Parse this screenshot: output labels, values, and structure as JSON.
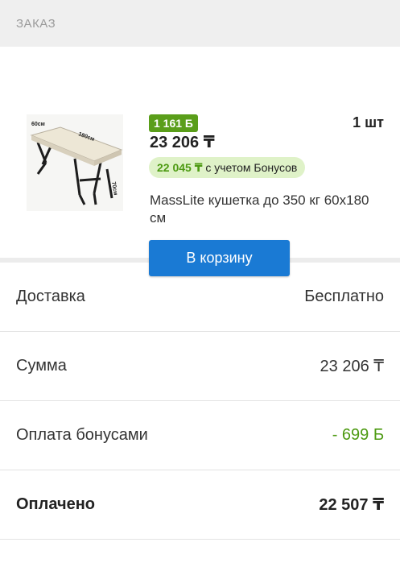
{
  "header": {
    "title": "ЗАКАЗ"
  },
  "order": {
    "bonus_badge": "1 161 Ƃ",
    "price": "23 206 ₸",
    "bonus_price_value": "22 045 ₸",
    "bonus_price_text": " с учетом Бонусов",
    "quantity": "1 шт",
    "title": "MassLite кушетка до 350 кг 60х180 см",
    "cart_button": "В корзину",
    "image_labels": {
      "width": "60см",
      "length": "180см",
      "height": "70см"
    }
  },
  "summary": [
    {
      "label": "Доставка",
      "value": "Бесплатно"
    },
    {
      "label": "Сумма",
      "value": "23 206 ₸"
    },
    {
      "label": "Оплата бонусами",
      "value": "- 699 Ƃ"
    },
    {
      "label": "Оплачено",
      "value": "22 507 ₸"
    }
  ],
  "colors": {
    "accent_blue": "#1a7ad4",
    "bonus_green": "#5a9e1a",
    "bonus_bg": "#dff2c8"
  }
}
